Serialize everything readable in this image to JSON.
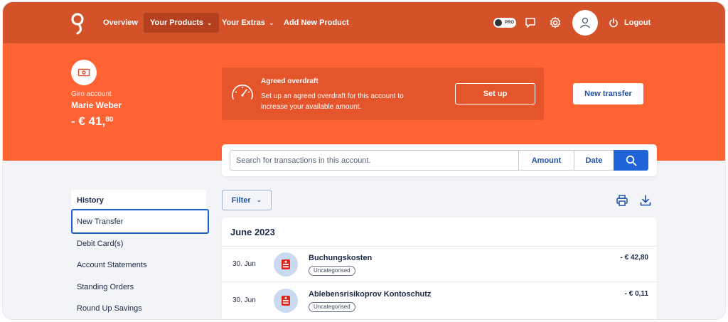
{
  "nav": {
    "links": [
      "Overview",
      "Your Products",
      "Your Extras",
      "Add New Product"
    ],
    "pro_label": "PRO",
    "logout": "Logout"
  },
  "account": {
    "type": "Giro account",
    "holder": "Marie Weber",
    "balance_main": "- € 41,",
    "balance_cents": "80"
  },
  "overdraft": {
    "title": "Agreed overdraft",
    "text": "Set up an agreed overdraft for this account to increase your available amount.",
    "button": "Set up"
  },
  "new_transfer_button": "New transfer",
  "search": {
    "placeholder": "Search for transactions in this account.",
    "amount": "Amount",
    "date": "Date"
  },
  "sidebar": {
    "items": [
      "History",
      "New Transfer",
      "Debit Card(s)",
      "Account Statements",
      "Standing Orders",
      "Round Up Savings"
    ]
  },
  "filter_label": "Filter",
  "transactions": {
    "month": "June 2023",
    "rows": [
      {
        "date": "30. Jun",
        "name": "Buchungskosten",
        "tag": "Uncategorised",
        "amount": "- € 42,80"
      },
      {
        "date": "30. Jun",
        "name": "Ablebensrisikoprov Kontoschutz",
        "tag": "Uncategorised",
        "amount": "- € 0,11"
      }
    ]
  },
  "colors": {
    "nav_bg": "#d4522a",
    "hero_bg": "#ff6233",
    "accent_blue": "#1f63d6",
    "bank_logo_red": "#e2231a"
  }
}
